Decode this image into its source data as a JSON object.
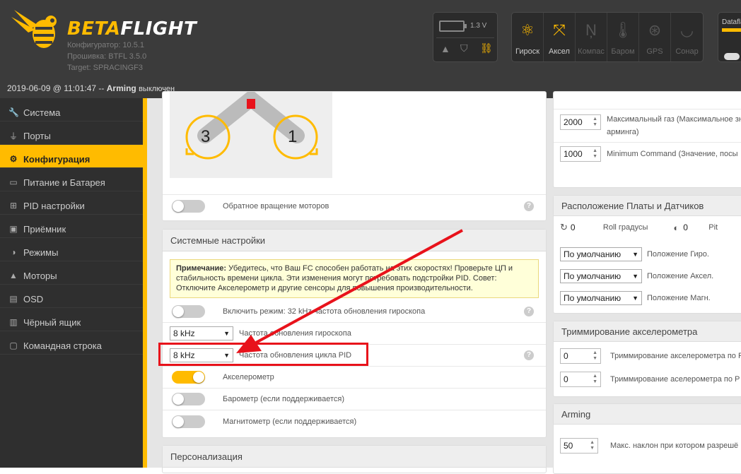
{
  "app": {
    "brand_part1": "BETA",
    "brand_part2": "FLIGHT",
    "configurator": "Конфигуратор: 10.5.1",
    "firmware": "Прошивка: BTFL 3.5.0",
    "target": "Target: SPRACINGF3"
  },
  "battery": {
    "voltage": "1.3 V"
  },
  "sensors": [
    {
      "label": "Гироск",
      "icon": "gyro-icon",
      "active": true
    },
    {
      "label": "Аксел",
      "icon": "accel-icon",
      "active": true
    },
    {
      "label": "Компас",
      "icon": "compass-icon",
      "active": false
    },
    {
      "label": "Баром",
      "icon": "baro-icon",
      "active": false
    },
    {
      "label": "GPS",
      "icon": "gps-icon",
      "active": false
    },
    {
      "label": "Сонар",
      "icon": "sonar-icon",
      "active": false
    }
  ],
  "dataflash": {
    "label": "Dataflash"
  },
  "status": {
    "datetime": "2019-06-09 @ 11:01:47 --",
    "arming": "Arming",
    "arming_state": "выключен"
  },
  "sidebar": {
    "items": [
      {
        "label": "Система",
        "icon": "wrench-icon"
      },
      {
        "label": "Порты",
        "icon": "plug-icon"
      },
      {
        "label": "Конфигурация",
        "icon": "gear-icon"
      },
      {
        "label": "Питание и Батарея",
        "icon": "battery-icon"
      },
      {
        "label": "PID настройки",
        "icon": "sitemap-icon"
      },
      {
        "label": "Приёмник",
        "icon": "receiver-icon"
      },
      {
        "label": "Режимы",
        "icon": "toggle-icon"
      },
      {
        "label": "Моторы",
        "icon": "motor-icon"
      },
      {
        "label": "OSD",
        "icon": "osd-icon"
      },
      {
        "label": "Чёрный ящик",
        "icon": "blackbox-icon"
      },
      {
        "label": "Командная строка",
        "icon": "terminal-icon"
      }
    ]
  },
  "motors": {
    "motor3": "3",
    "motor1": "1",
    "reverse_label": "Обратное вращение моторов"
  },
  "system": {
    "title": "Системные настройки",
    "note_bold": "Примечание:",
    "note_text": "Убедитесь, что Ваш FC способен работать на этих скоростях! Проверьте ЦП и стабильность времени цикла. Эти изменения могут потребовать подстройки PID. Совет: Отключите Акселерометр и другие сенсоры для повышения производительности.",
    "gyro32_label": "Включить режим: 32 kHz частота обновления гироскопа",
    "gyro_rate_value": "8 kHz",
    "gyro_rate_label": "Частота обновления гироскопа",
    "pid_rate_value": "8 kHz",
    "pid_rate_label": "Частота обновления цикла PID",
    "accel_label": "Акселерометр",
    "baro_label": "Барометр (если поддерживается)",
    "mag_label": "Магнитометр (если поддерживается)"
  },
  "personalization": {
    "title": "Персонализация"
  },
  "right": {
    "max_throttle_value": "2000",
    "max_throttle_label": "Максимальный газ (Максимальное зн",
    "max_throttle_label2": "арминга)",
    "min_command_value": "1000",
    "min_command_label": "Minimum Command (Значение, посы",
    "board_title": "Расположение Платы и Датчиков",
    "roll_value": "0",
    "roll_label": "Roll градусы",
    "pitch_value": "0",
    "pitch_label": "Pit",
    "gyro_align_value": "По умолчанию",
    "gyro_align_label": "Положение Гиро.",
    "acc_align_value": "По умолчанию",
    "acc_align_label": "Положение Аксел.",
    "mag_align_value": "По умолчанию",
    "mag_align_label": "Положение Магн.",
    "trim_title": "Триммирование акселерометра",
    "trim1_value": "0",
    "trim1_label": "Триммирование акселерометра по R",
    "trim2_value": "0",
    "trim2_label": "Триммирование аселерометра по Р",
    "arming_title": "Arming",
    "angle_value": "50",
    "angle_label": "Макс. наклон при котором разрешё"
  },
  "colors": {
    "accent": "#ffbb00",
    "highlight": "#e8121b"
  }
}
